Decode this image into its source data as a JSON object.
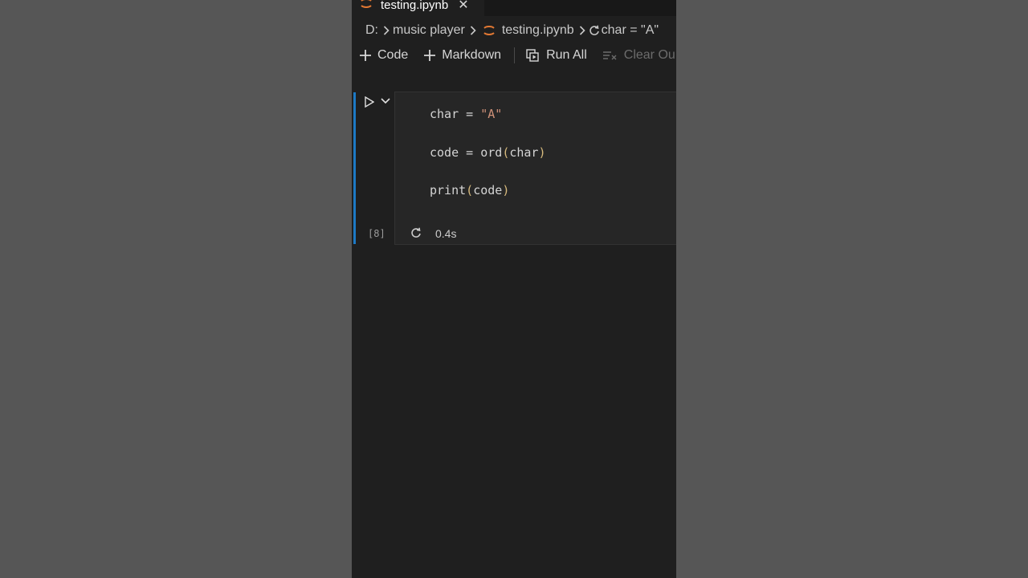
{
  "tab": {
    "title": "testing.ipynb",
    "close_label": "✕"
  },
  "breadcrumb": {
    "drive": "D:",
    "folder": "music player",
    "file": "testing.ipynb",
    "symbol": "char = \"A\""
  },
  "toolbar": {
    "code_label": "Code",
    "markdown_label": "Markdown",
    "run_all_label": "Run All",
    "clear_label": "Clear Ou"
  },
  "cell": {
    "line1": {
      "var": "char",
      "op": " = ",
      "str": "\"A\""
    },
    "line2": {
      "var": "code",
      "op": " = ",
      "fn": "ord",
      "open": "(",
      "arg": "char",
      "close": ")"
    },
    "line3": {
      "fn": "print",
      "open": "(",
      "arg": "code",
      "close": ")"
    },
    "exec_count": "[8]",
    "exec_time": "0.4s"
  },
  "icons": {
    "tab_icon": "jupyter-icon",
    "run": "play-icon",
    "collapse": "chevron-down-icon",
    "status": "refresh-icon"
  },
  "colors": {
    "accent_bar": "#1c79c5",
    "jupyter_orange": "#e37933",
    "string": "#ce9178",
    "paren": "#d7ba7d"
  }
}
